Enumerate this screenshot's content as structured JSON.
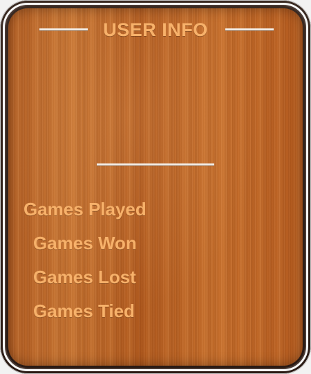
{
  "user_info": {
    "title": "USER INFO",
    "stats": [
      {
        "label": "Games Played"
      },
      {
        "label": "Games Won"
      },
      {
        "label": "Games Lost"
      },
      {
        "label": "Games Tied"
      }
    ]
  }
}
